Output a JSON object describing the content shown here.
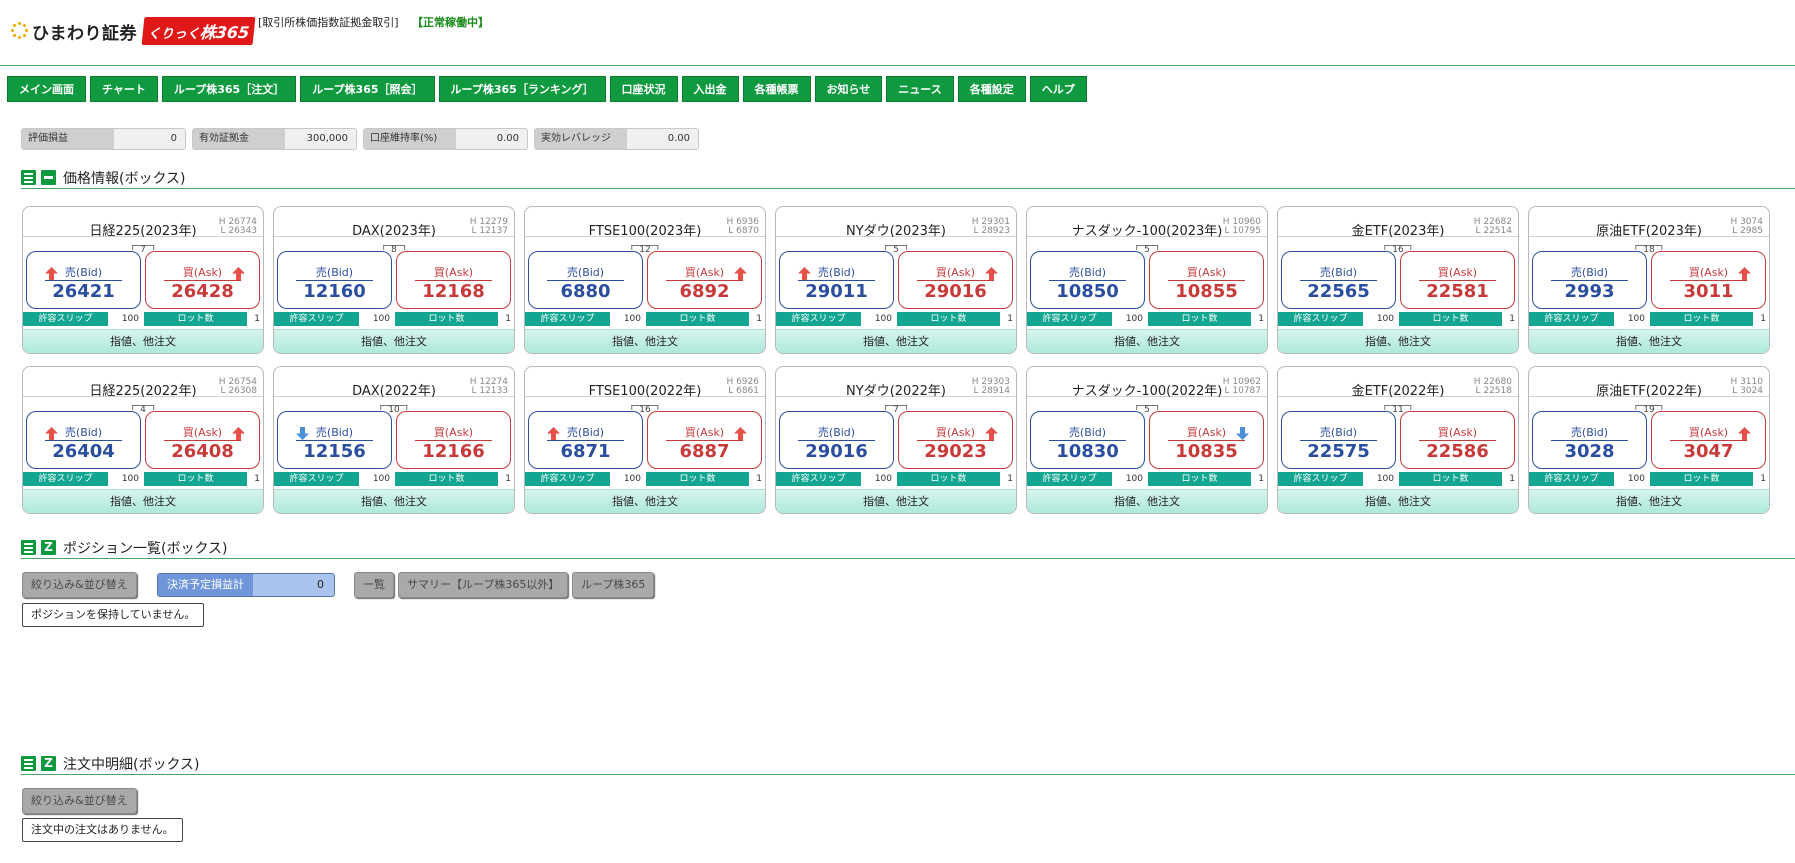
{
  "header": {
    "brand": "ひまわり証券",
    "product_prefix": "くりっく",
    "product_name": "株365",
    "note": "[取引所株価指数証拠金取引]",
    "status": "【正常稼働中】"
  },
  "nav": [
    "メイン画面",
    "チャート",
    "ループ株365［注文］",
    "ループ株365［照会］",
    "ループ株365［ランキング］",
    "口座状況",
    "入出金",
    "各種帳票",
    "お知らせ",
    "ニュース",
    "各種設定",
    "ヘルプ"
  ],
  "summary": [
    {
      "label": "評価損益",
      "value": "0"
    },
    {
      "label": "有効証拠金",
      "value": "300,000"
    },
    {
      "label": "口座維持率(%)",
      "value": "0.00"
    },
    {
      "label": "実効レバレッジ(倍)",
      "value": "0.00"
    }
  ],
  "sections": {
    "price": "価格情報(ボックス)",
    "positions": "ポジション一覧(ボックス)",
    "orders": "注文中明細(ボックス)"
  },
  "card_labels": {
    "bid": "売(Bid)",
    "ask": "買(Ask)",
    "slip": "許容スリップ",
    "lot": "ロット数",
    "footer": "指値、他注文"
  },
  "cards": [
    {
      "name": "日経225(2023年)",
      "high": "H 26774",
      "low": "L 26343",
      "spread": "7",
      "bid": "26421",
      "ask": "26428",
      "bid_arrow": "up",
      "ask_arrow": "up",
      "slip": "100",
      "lot": "1"
    },
    {
      "name": "DAX(2023年)",
      "high": "H 12279",
      "low": "L 12137",
      "spread": "8",
      "bid": "12160",
      "ask": "12168",
      "bid_arrow": "",
      "ask_arrow": "",
      "slip": "100",
      "lot": "1"
    },
    {
      "name": "FTSE100(2023年)",
      "high": "H 6936",
      "low": "L 6870",
      "spread": "12",
      "bid": "6880",
      "ask": "6892",
      "bid_arrow": "",
      "ask_arrow": "up",
      "slip": "100",
      "lot": "1"
    },
    {
      "name": "NYダウ(2023年)",
      "high": "H 29301",
      "low": "L 28923",
      "spread": "5",
      "bid": "29011",
      "ask": "29016",
      "bid_arrow": "up",
      "ask_arrow": "up",
      "slip": "100",
      "lot": "1"
    },
    {
      "name": "ナスダック-100(2023年)",
      "high": "H 10960",
      "low": "L 10795",
      "spread": "5",
      "bid": "10850",
      "ask": "10855",
      "bid_arrow": "",
      "ask_arrow": "",
      "slip": "100",
      "lot": "1"
    },
    {
      "name": "金ETF(2023年)",
      "high": "H 22682",
      "low": "L 22514",
      "spread": "16",
      "bid": "22565",
      "ask": "22581",
      "bid_arrow": "",
      "ask_arrow": "",
      "slip": "100",
      "lot": "1"
    },
    {
      "name": "原油ETF(2023年)",
      "high": "H 3074",
      "low": "L 2985",
      "spread": "18",
      "bid": "2993",
      "ask": "3011",
      "bid_arrow": "",
      "ask_arrow": "up",
      "slip": "100",
      "lot": "1"
    },
    {
      "name": "日経225(2022年)",
      "high": "H 26754",
      "low": "L 26308",
      "spread": "4",
      "bid": "26404",
      "ask": "26408",
      "bid_arrow": "up",
      "ask_arrow": "up",
      "slip": "100",
      "lot": "1"
    },
    {
      "name": "DAX(2022年)",
      "high": "H 12274",
      "low": "L 12133",
      "spread": "10",
      "bid": "12156",
      "ask": "12166",
      "bid_arrow": "down",
      "ask_arrow": "",
      "slip": "100",
      "lot": "1"
    },
    {
      "name": "FTSE100(2022年)",
      "high": "H 6926",
      "low": "L 6861",
      "spread": "16",
      "bid": "6871",
      "ask": "6887",
      "bid_arrow": "up",
      "ask_arrow": "up",
      "slip": "100",
      "lot": "1"
    },
    {
      "name": "NYダウ(2022年)",
      "high": "H 29303",
      "low": "L 28914",
      "spread": "7",
      "bid": "29016",
      "ask": "29023",
      "bid_arrow": "",
      "ask_arrow": "up",
      "slip": "100",
      "lot": "1"
    },
    {
      "name": "ナスダック-100(2022年)",
      "high": "H 10962",
      "low": "L 10787",
      "spread": "5",
      "bid": "10830",
      "ask": "10835",
      "bid_arrow": "",
      "ask_arrow": "down",
      "slip": "100",
      "lot": "1"
    },
    {
      "name": "金ETF(2022年)",
      "high": "H 22680",
      "low": "L 22518",
      "spread": "11",
      "bid": "22575",
      "ask": "22586",
      "bid_arrow": "",
      "ask_arrow": "",
      "slip": "100",
      "lot": "1"
    },
    {
      "name": "原油ETF(2022年)",
      "high": "H 3110",
      "low": "L 3024",
      "spread": "19",
      "bid": "3028",
      "ask": "3047",
      "bid_arrow": "",
      "ask_arrow": "up",
      "slip": "100",
      "lot": "1"
    }
  ],
  "positions": {
    "filter_button": "絞り込み&並び替え",
    "pnl_label": "決済予定損益計",
    "pnl_value": "0",
    "tabs": [
      "一覧",
      "サマリー【ループ株365以外】",
      "ループ株365"
    ],
    "empty_message": "ポジションを保持していません。"
  },
  "orders": {
    "filter_button": "絞り込み&並び替え",
    "empty_message": "注文中の注文はありません。"
  },
  "colors": {
    "nav_green": "#0f9a3f",
    "bid_blue": "#2b4f9e",
    "ask_red": "#c83a3a",
    "slip_teal": "#12a590",
    "up_arrow": "#e8504a",
    "down_arrow": "#4a8fd8"
  }
}
